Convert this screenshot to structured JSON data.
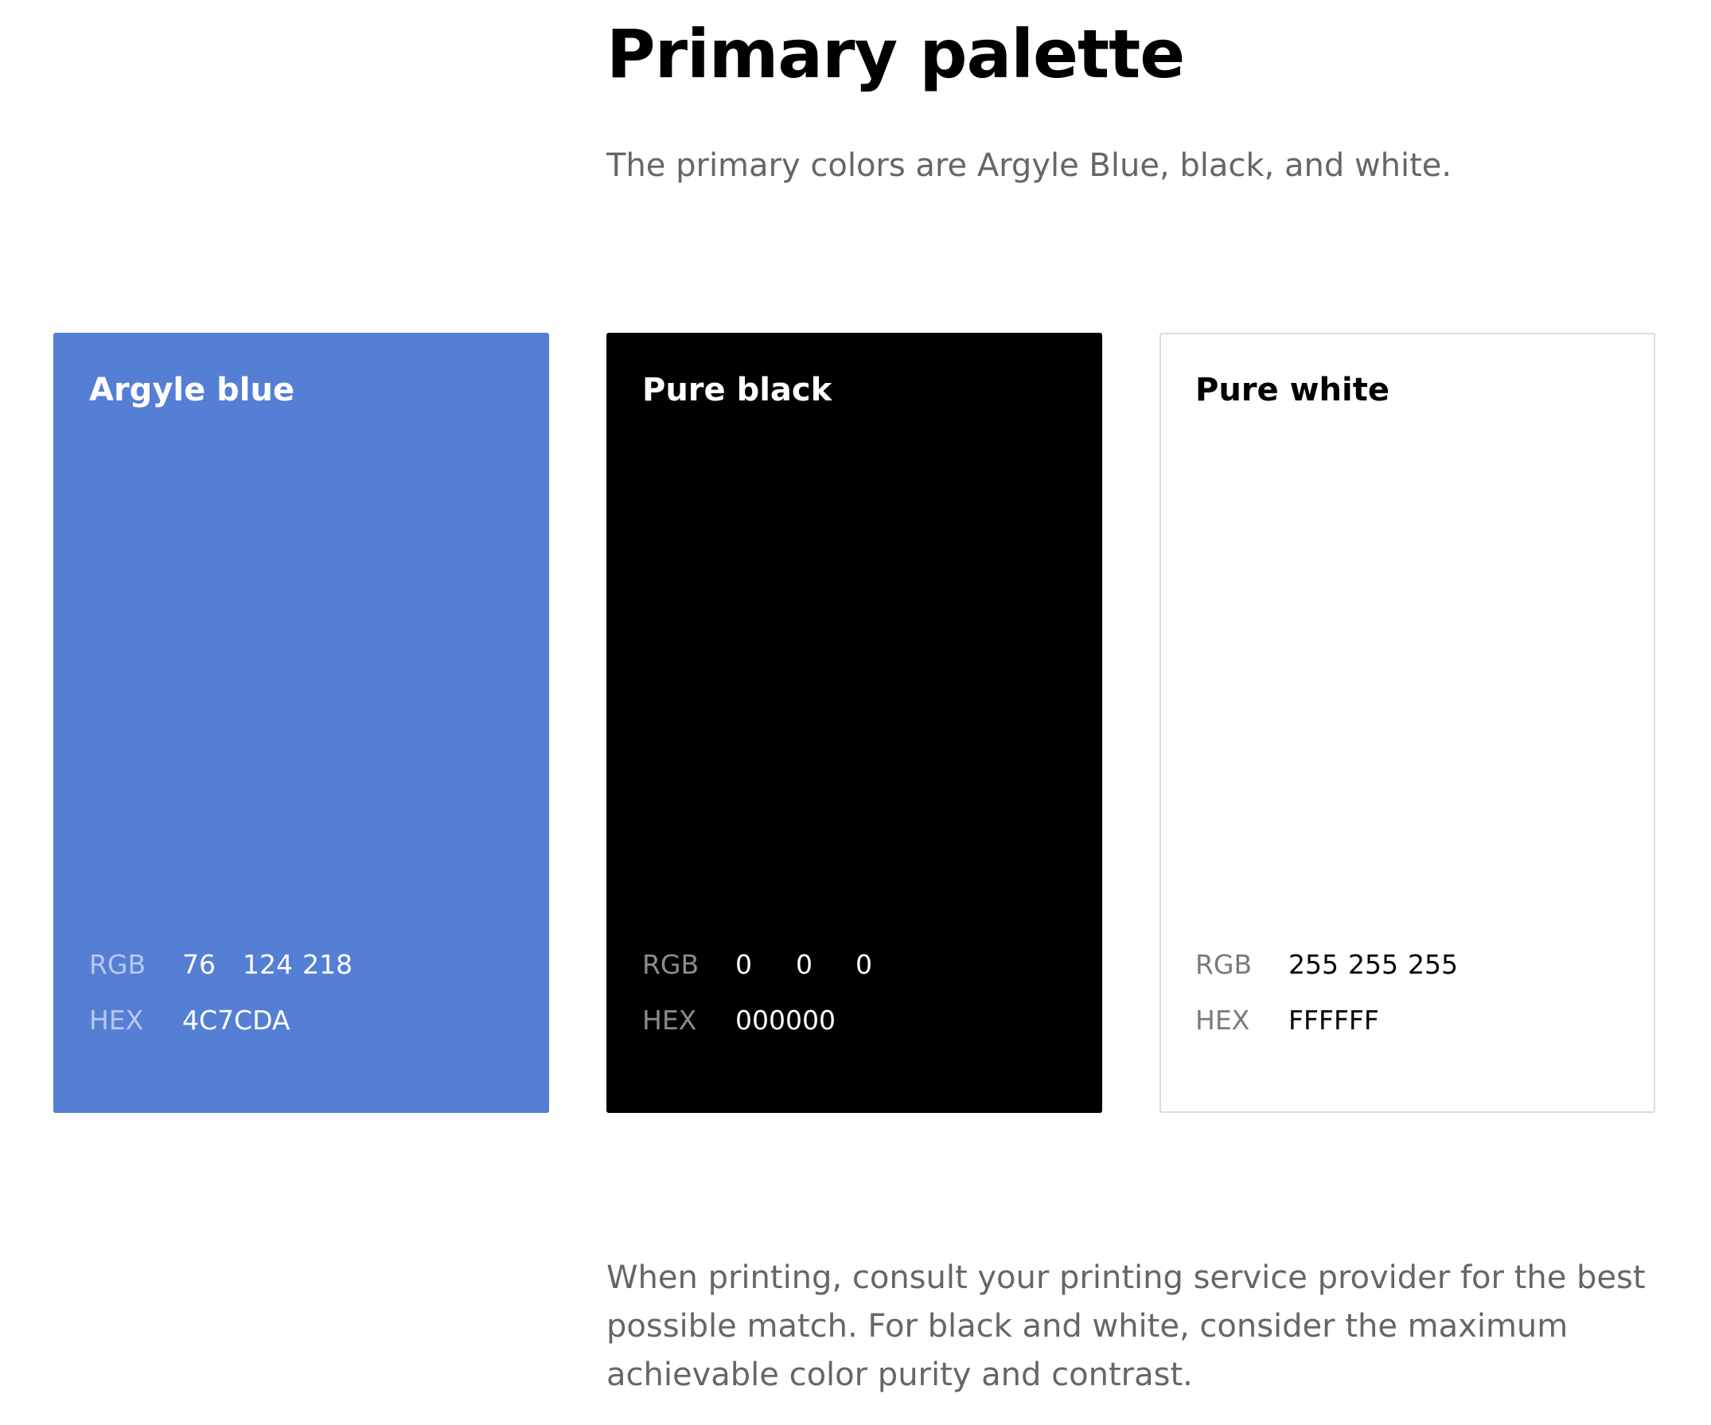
{
  "header": {
    "title": "Primary palette",
    "intro": "The primary colors are Argyle Blue, black, and white."
  },
  "swatches": [
    {
      "name": "Argyle blue",
      "background": "#557ED5",
      "name_color": "#FFFFFF",
      "label_color": "#B8C9EE",
      "value_color": "#FFFFFF",
      "rgb_label": "RGB",
      "rgb": [
        "76",
        "124",
        "218"
      ],
      "hex_label": "HEX",
      "hex": "4C7CDA"
    },
    {
      "name": "Pure black",
      "background": "#000000",
      "name_color": "#FFFFFF",
      "label_color": "#8C8C8C",
      "value_color": "#FFFFFF",
      "rgb_label": "RGB",
      "rgb": [
        "0",
        "0",
        "0"
      ],
      "hex_label": "HEX",
      "hex": "000000"
    },
    {
      "name": "Pure white",
      "background": "#FFFFFF",
      "border": "#DCDCDC",
      "name_color": "#000000",
      "label_color": "#7A7A7A",
      "value_color": "#000000",
      "rgb_label": "RGB",
      "rgb": [
        "255",
        "255",
        "255"
      ],
      "hex_label": "HEX",
      "hex": "FFFFFF"
    }
  ],
  "footer": {
    "note": "When printing, consult your printing service provider for the best possible match. For black and white, consider the maximum achievable color purity and contrast."
  }
}
